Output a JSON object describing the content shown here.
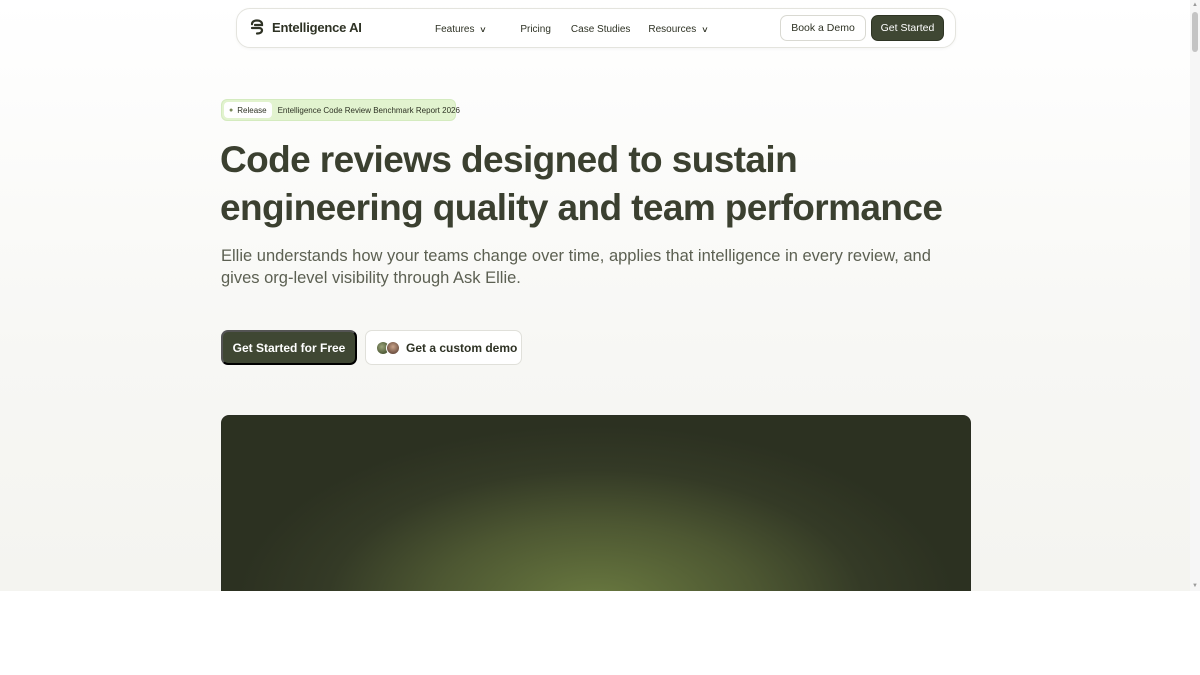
{
  "nav": {
    "logo_text": "Entelligence AI",
    "links": [
      {
        "label": "Features",
        "has_dropdown": true
      },
      {
        "label": "Pricing",
        "has_dropdown": false
      },
      {
        "label": "Case Studies",
        "has_dropdown": false
      },
      {
        "label": "Resources",
        "has_dropdown": true
      }
    ],
    "book_demo_label": "Book a Demo",
    "get_started_label": "Get Started"
  },
  "badge": {
    "tag": "Release",
    "text": "Entelligence Code Review Benchmark Report 2026"
  },
  "hero": {
    "title": "Code reviews designed to sustain engineering quality and team performance",
    "subtitle": "Ellie understands how your teams change over time, applies that intelligence in every review, and gives org-level visibility through Ask Ellie.",
    "cta_primary": "Get Started for Free",
    "cta_secondary": "Get a custom demo"
  },
  "colors": {
    "accent": "#3f4733",
    "badge_bg": "#e2f3cf",
    "preview_glow": "#6a7a40"
  },
  "icons": {
    "logo": "entelligence-logo-icon",
    "dropdown": "chevron-down-icon"
  }
}
